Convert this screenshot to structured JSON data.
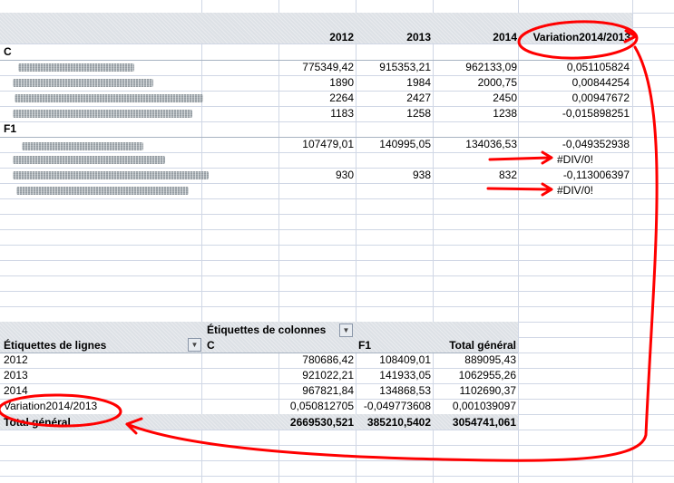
{
  "top_table": {
    "headers": [
      "2012",
      "2013",
      "2014",
      "Variation2014/2013"
    ],
    "groups": [
      {
        "name": "C",
        "rows": [
          [
            "775349,42",
            "915353,21",
            "962133,09",
            "0,051105824"
          ],
          [
            "1890",
            "1984",
            "2000,75",
            "0,00844254"
          ],
          [
            "2264",
            "2427",
            "2450",
            "0,00947672"
          ],
          [
            "1183",
            "1258",
            "1238",
            "-0,015898251"
          ]
        ]
      },
      {
        "name": "F1",
        "rows": [
          [
            "107479,01",
            "140995,05",
            "134036,53",
            "-0,049352938"
          ],
          [
            "",
            "",
            "",
            "#DIV/0!"
          ],
          [
            "930",
            "938",
            "832",
            "-0,113006397"
          ],
          [
            "",
            "",
            "",
            "#DIV/0!"
          ]
        ]
      }
    ]
  },
  "pivot": {
    "col_labels_caption": "Étiquettes de colonnes",
    "row_labels_caption": "Étiquettes de lignes",
    "col_headers": [
      "C",
      "F1",
      "Total général"
    ],
    "rows": [
      {
        "label": "2012",
        "values": [
          "780686,42",
          "108409,01",
          "889095,43"
        ]
      },
      {
        "label": "2013",
        "values": [
          "921022,21",
          "141933,05",
          "1062955,26"
        ]
      },
      {
        "label": "2014",
        "values": [
          "967821,84",
          "134868,53",
          "1102690,37"
        ]
      },
      {
        "label": "Variation2014/2013",
        "values": [
          "0,050812705",
          "-0,049773608",
          "0,001039097"
        ]
      }
    ],
    "total": {
      "label": "Total général",
      "values": [
        "2669530,521",
        "385210,5402",
        "3054741,061"
      ]
    }
  },
  "colors": {
    "annotation": "#ff0000",
    "header_band": "#dde1e6",
    "gridline": "#d0d7e5"
  }
}
